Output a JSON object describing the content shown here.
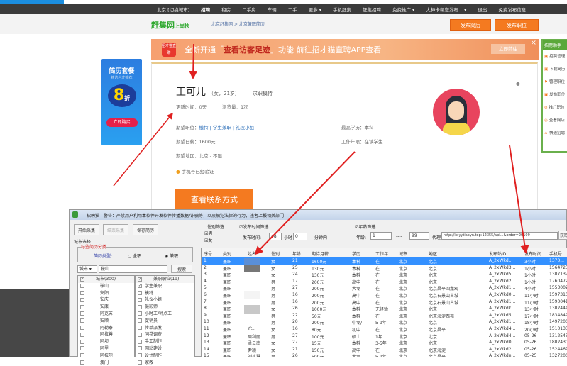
{
  "nav": {
    "items": [
      "北京 [切换城市]",
      "招聘",
      "租房",
      "二手房",
      "车辆",
      "二手",
      "更多 ▾",
      "手机赶集",
      "赶集招聘",
      "免费推广 ▾",
      "大神卡帮您发布... ▾",
      "退出",
      "免费发布信息"
    ],
    "active": 1
  },
  "header": {
    "logo": "赶集网",
    "logo_sub": "上岗快",
    "breadcrumb": "北京赶集网 > 北京兼职简历",
    "post_resume": "发布简历",
    "post_job": "发布职位"
  },
  "ad": {
    "title": "简历套餐",
    "sub": "精选人才推荐",
    "discount": "8",
    "discount_suffix": "折",
    "button": "立即购买"
  },
  "banner": {
    "icon_text": "招才猫直聘",
    "text_pre": "全新开通「",
    "text_highlight": "查看访客足迹",
    "text_post": "」功能 前往招才猫直聘APP查看",
    "go": "立即前往",
    "close": "×"
  },
  "profile": {
    "name": "王可儿",
    "meta": "（女，21岁）",
    "job": "求职模特",
    "update": "更新时间：0天",
    "views": "浏览量：1次",
    "expect_pos_label": "期望职位：",
    "expect_pos": "模特 | 学生兼职 | 礼仪小姐",
    "salary": "期望日薪：1600元",
    "area": "期望地区：北京 - 不限",
    "verified": "手机号已经验证",
    "edu": "最高学历：本科",
    "years": "工作年限：在读学生",
    "contact": "查看联系方式"
  },
  "sidebar": {
    "title": "招聘助手",
    "items": [
      "招聘管理",
      "下载简历",
      "管理职位",
      "发布职位",
      "推广职位",
      "查看网店",
      "快速招聘"
    ]
  },
  "app": {
    "title": "—招聘猫—警告：严禁用户利用本软件开发软件传播数据/诈骗等，以及触犯法律的行为，违者上报相关部门",
    "start": "开始采集",
    "stop": "结束采集",
    "save": "保存简历",
    "city_select": "城市选择",
    "group": "标签简历分类",
    "resume_type": "简历类型:",
    "fulltime": "全职",
    "parttime": "兼职",
    "city_combo": "城市 ▾",
    "search_value": "鞍山",
    "search_btn": "搜索",
    "gender_filter": "性别筛选",
    "male": "男",
    "female": "女",
    "time_filter": "发布时间筛选",
    "time_label": "发布时间:",
    "hours": "48",
    "hours_unit": "小时",
    "minutes": "0",
    "minutes_unit": "分钟内",
    "age_filter": "年龄筛选",
    "age_label": "年龄:",
    "age_min": "1",
    "age_sep": "----",
    "age_max": "99",
    "proxy_label": "代理:",
    "proxy": "http://ip.yytiaoyn.top:12355/api...&order=20109",
    "get": "获取",
    "city_header": "城市(300)",
    "cities": [
      "鞍山",
      "安阳",
      "安庆",
      "安康",
      "阿克苏",
      "安顺",
      "阿勒泰",
      "阿拉善",
      "阿坝",
      "阿里",
      "阿拉尔",
      "澳门"
    ],
    "pos_header": "兼职职位(19)",
    "positions": [
      "学生兼职",
      "模特",
      "礼仪小姐",
      "摄影师",
      "小时工/钟点工",
      "促销员",
      "传单派发",
      "问卷调查",
      "手工制作",
      "网站建设",
      "设计制作",
      "家教"
    ],
    "columns": [
      "序号",
      "类别",
      "姓名",
      "性别",
      "年龄",
      "期待月薪",
      "学历",
      "工作年",
      "城市",
      "地区",
      "发布站ID",
      "发布时间",
      "手机号"
    ],
    "rows": [
      [
        "1",
        "兼职",
        "",
        "女",
        "21",
        "1600元",
        "本科",
        "在",
        "北京",
        "北京",
        "A_2xWkd...",
        "3小时",
        "1370..."
      ],
      [
        "2",
        "兼职",
        "",
        "女",
        "25",
        "130元",
        "本科",
        "在",
        "北京",
        "北京",
        "A_2xWkd3...",
        "1小时",
        "15647235"
      ],
      [
        "3",
        "兼职",
        "",
        "女",
        "24",
        "130元",
        "本科",
        "在",
        "北京",
        "北京",
        "A_2xWkd5...",
        "1小时",
        "13071379"
      ],
      [
        "4",
        "兼职",
        "",
        "男",
        "17",
        "200元",
        "高中",
        "在",
        "北京",
        "北京",
        "A_2xWkd2...",
        "1小时",
        "17604723"
      ],
      [
        "5",
        "兼职",
        "",
        "男",
        "27",
        "200元",
        "大专",
        "在",
        "北京",
        "北京昌平回龙观",
        "A_2xWkd1...",
        "4小时",
        "15530024"
      ],
      [
        "6",
        "兼职",
        "",
        "男",
        "16",
        "200元",
        "高中",
        "在",
        "北京",
        "北京石景山古城",
        "A_2xWkd0...",
        "11小时",
        "15973100"
      ],
      [
        "7",
        "兼职",
        "",
        "男",
        "16",
        "200元",
        "高中",
        "在",
        "北京",
        "北京石景山古城",
        "A_2xWkd1...",
        "11小时",
        "15900410"
      ],
      [
        "8",
        "兼职",
        "",
        "女",
        "26",
        "1000元",
        "本科",
        "无经验",
        "北京",
        "北京",
        "A_2xWkdk...",
        "13小时",
        "13024442"
      ],
      [
        "9",
        "兼职",
        "",
        "男",
        "22",
        "50元",
        "本科",
        "在",
        "北京",
        "北京海淀西苑",
        "A_2xWkd5...",
        "17小时",
        "18348495"
      ],
      [
        "10",
        "兼职",
        "",
        "男",
        "20",
        "200元",
        "中专/",
        "5-9年",
        "北京",
        "北京",
        "A_2xWkd1...",
        "18小时",
        "14972065"
      ],
      [
        "11",
        "兼职",
        "Yt..",
        "女",
        "16",
        "80元",
        "初中",
        "在",
        "北京",
        "北京昌平",
        "A_2xWkd4...",
        "20小时",
        "15101330"
      ],
      [
        "12",
        "兼职",
        "周利丽",
        "男",
        "27",
        "100元",
        "硕士",
        "1年",
        "北京",
        "北京",
        "A_2xWkd4...",
        "05-26",
        "13125430"
      ],
      [
        "13",
        "兼职",
        "孟云南",
        "女",
        "27",
        "15元",
        "本科",
        "3-5年",
        "北京",
        "北京",
        "A_2xWkd0...",
        "05-26",
        "18024303"
      ],
      [
        "14",
        "兼职",
        "尹颖",
        "女",
        "21",
        "150元",
        "高中",
        "在",
        "北京",
        "北京海淀",
        "A_2xWkd2...",
        "05-26",
        "15244673"
      ],
      [
        "15",
        "兼职",
        "刘礼慧",
        "男",
        "26",
        "500元",
        "大专",
        "5-9年",
        "北京",
        "北京昌平",
        "A_2xWkdn...",
        "05-25",
        "13272067"
      ],
      [
        "16",
        "兼职",
        "刘未丽",
        "女",
        "18",
        "100元",
        "中专/",
        "在",
        "北京",
        "北京昌平",
        "A_2xWkd0...",
        "05-25",
        "15898..."
      ]
    ],
    "selected_row": 0
  },
  "colors": {
    "accent_orange": "#f47a20",
    "nav_dark": "#3b3b3b",
    "selection_blue": "#3390ff",
    "annotation_red": "#e02020",
    "brand_green": "#2ea82e"
  }
}
